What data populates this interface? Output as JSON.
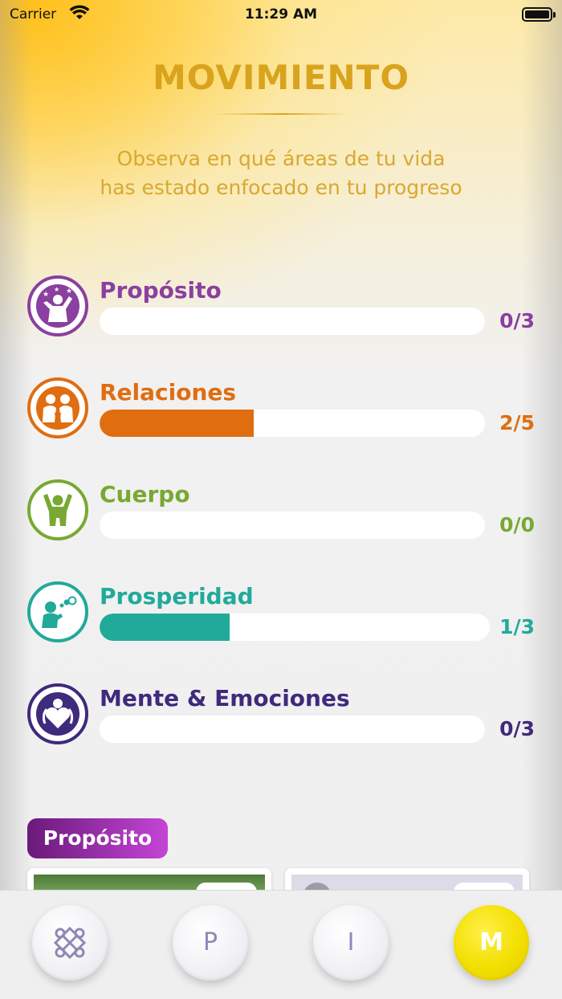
{
  "status_bar": {
    "carrier": "Carrier",
    "time": "11:29 AM"
  },
  "header": {
    "title": "MOVIMIENTO",
    "subtitle": "Observa en qué áreas de tu vida has estado enfocado en tu progreso"
  },
  "categories": [
    {
      "name": "Propósito",
      "count": "0/3",
      "progress": 0,
      "color": "#8b3fa0",
      "icon": "celebrating-person-icon"
    },
    {
      "name": "Relaciones",
      "count": "2/5",
      "progress": 0.4,
      "color": "#e06d10",
      "icon": "two-people-icon"
    },
    {
      "name": "Cuerpo",
      "count": "0/0",
      "progress": 0,
      "color": "#78a832",
      "icon": "raised-arms-person-icon"
    },
    {
      "name": "Prosperidad",
      "count": "1/3",
      "progress": 0.333,
      "color": "#21aa9a",
      "icon": "person-thinking-icon"
    },
    {
      "name": "Mente & Emociones",
      "count": "0/3",
      "progress": 0,
      "color": "#3f2a7c",
      "icon": "heart-person-icon"
    }
  ],
  "section_tag": "Propósito",
  "tabbar": {
    "tabs": [
      {
        "label": "",
        "icon": "knot-icon"
      },
      {
        "label": "P"
      },
      {
        "label": "I"
      },
      {
        "label": "M",
        "active": true
      }
    ]
  }
}
